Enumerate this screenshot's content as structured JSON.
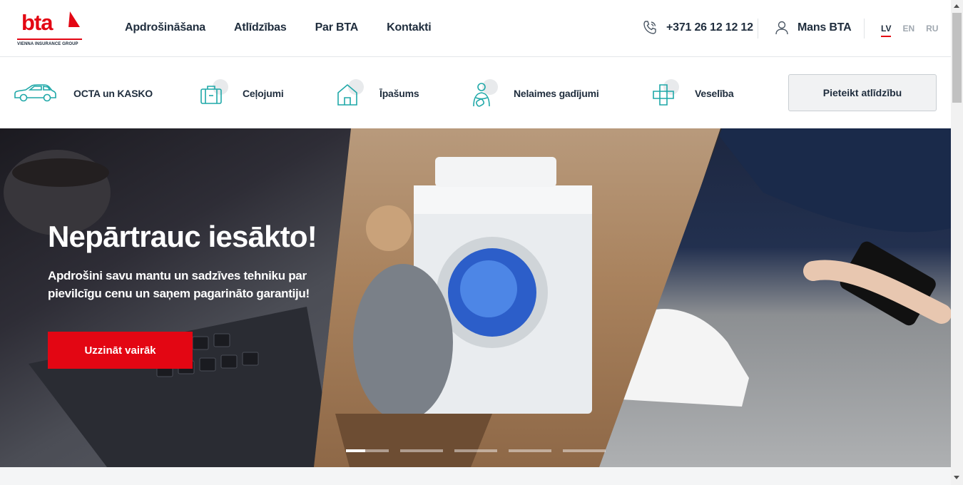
{
  "logo": {
    "word": "bta",
    "subtitle": "VIENNA INSURANCE GROUP",
    "brand_color": "#e30613"
  },
  "nav": [
    "Apdrošināšana",
    "Atlīdzības",
    "Par BTA",
    "Kontakti"
  ],
  "phone": {
    "icon": "phone-icon",
    "number": "+371 26 12 12 12"
  },
  "account": {
    "icon": "user-icon",
    "label": "Mans BTA"
  },
  "languages": {
    "items": [
      "LV",
      "EN",
      "RU"
    ],
    "active": "LV"
  },
  "products": [
    {
      "icon": "car-icon",
      "label": "OCTA un KASKO"
    },
    {
      "icon": "suitcase-icon",
      "label": "Ceļojumi"
    },
    {
      "icon": "house-icon",
      "label": "Īpašums"
    },
    {
      "icon": "injury-icon",
      "label": "Nelaimes gadījumi"
    },
    {
      "icon": "cross-icon",
      "label": "Veselība"
    }
  ],
  "claim_button": "Pieteikt atlīdzību",
  "hero": {
    "title": "Nepārtrauc iesākto!",
    "text": "Apdrošini savu mantu un sadzīves tehniku par pievilcīgu cenu un saņem pagarināto garantiju!",
    "button": "Uzzināt vairāk",
    "slides_total": 5,
    "slide_active": 1,
    "active_progress": 0.45
  },
  "colors": {
    "accent": "#e30613",
    "icon_teal": "#1fa8a8",
    "text": "#1f2d3d"
  }
}
